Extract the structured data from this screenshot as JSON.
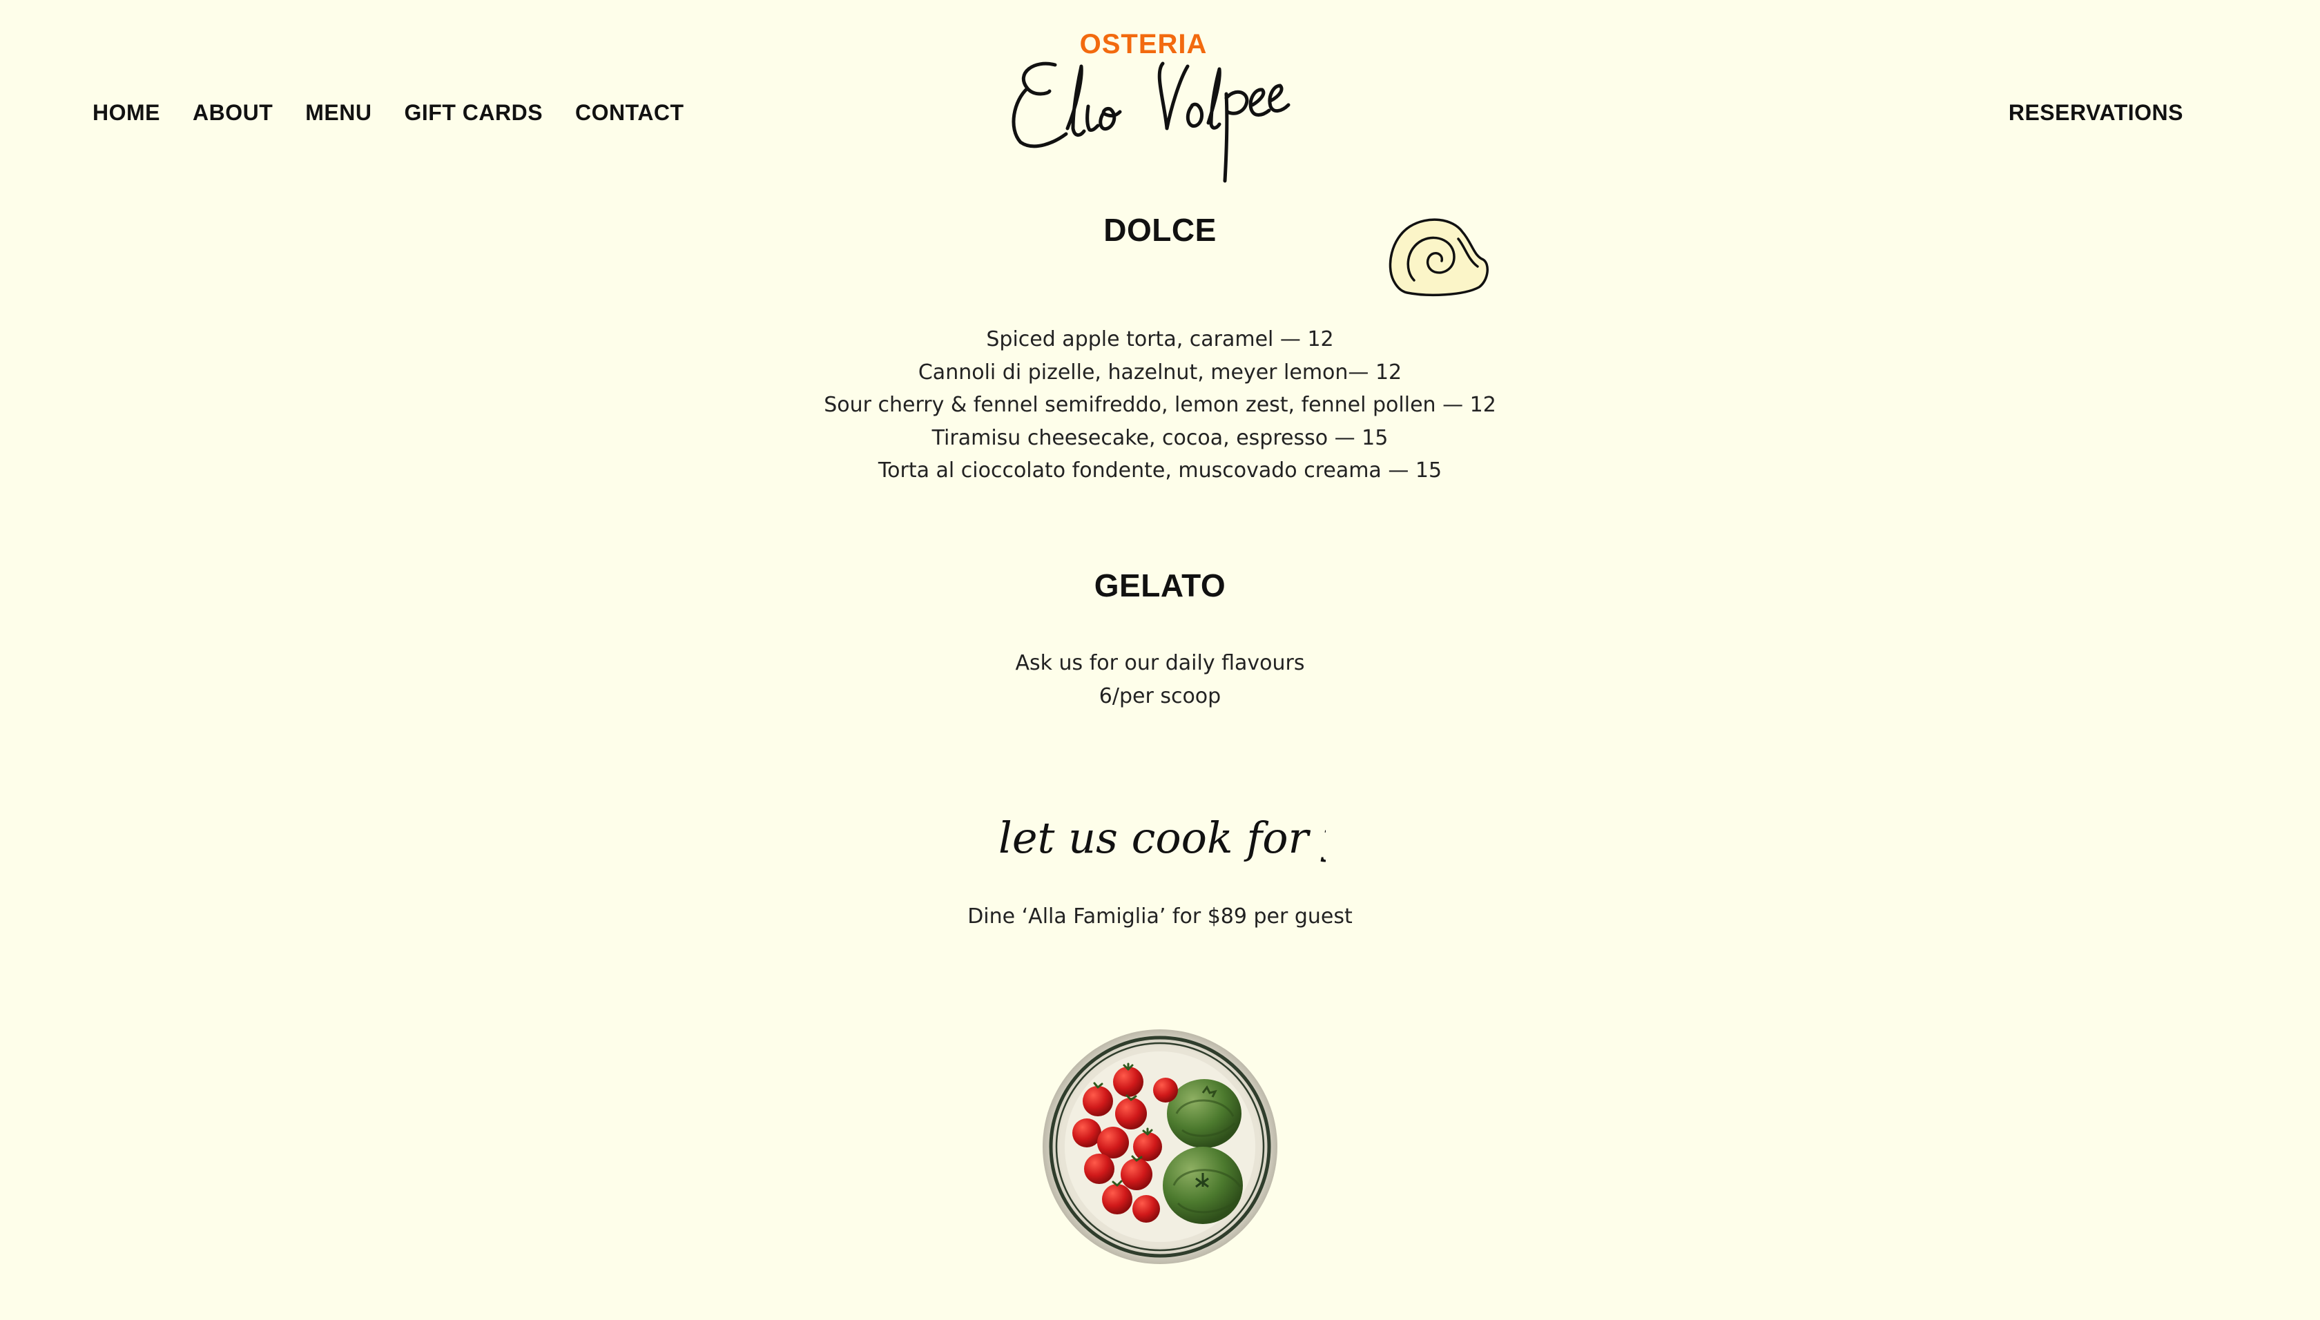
{
  "nav": {
    "items": [
      "HOME",
      "ABOUT",
      "MENU",
      "GIFT CARDS",
      "CONTACT"
    ],
    "reservations_label": "RESERVATIONS"
  },
  "logo": {
    "eyebrow": "OSTERIA",
    "script_name": "Elio Volpe",
    "accent_color": "#f26a0f"
  },
  "dolce": {
    "title": "DOLCE",
    "items": [
      "Spiced apple torta, caramel — 12",
      "Cannoli di pizelle, hazelnut, meyer lemon— 12",
      "Sour cherry & fennel semifreddo, lemon zest, fennel pollen — 12",
      "Tiramisu cheesecake, cocoa, espresso — 15",
      "Torta al cioccolato fondente, muscovado creama — 15"
    ]
  },
  "gelato": {
    "title": "GELATO",
    "lines": [
      "Ask us for our daily flavours",
      "6/per scoop"
    ]
  },
  "family": {
    "script_heading": "let us cook for you",
    "description": "Dine ‘Alla Famiglia’ for $89 per guest"
  },
  "icons": {
    "snail": "snail-illustration-icon",
    "plate": "tomato-plate-image"
  },
  "colors": {
    "background": "#fefeea",
    "text": "#111111",
    "accent": "#f26a0f",
    "snail_fill": "#fbf5c8"
  }
}
